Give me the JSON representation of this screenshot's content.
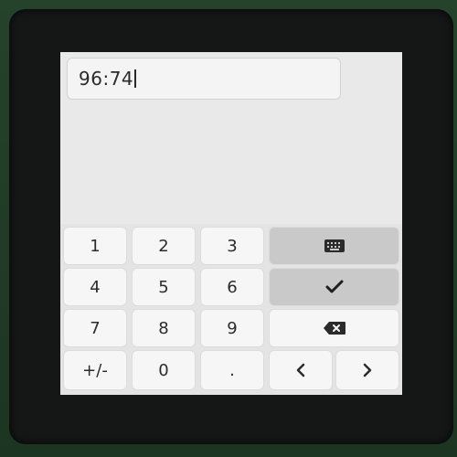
{
  "textarea": {
    "value": "96:74"
  },
  "keyboard": {
    "keys": {
      "k1": "1",
      "k2": "2",
      "k3": "3",
      "k4": "4",
      "k5": "5",
      "k6": "6",
      "k7": "7",
      "k8": "8",
      "k9": "9",
      "plusminus": "+/-",
      "k0": "0",
      "dot": "."
    },
    "icons": {
      "keyboard": "keyboard-icon",
      "ok": "checkmark-icon",
      "backspace": "backspace-icon",
      "left": "chevron-left-icon",
      "right": "chevron-right-icon"
    }
  },
  "colors": {
    "screen_bg": "#e9e9e9",
    "key_bg": "#f6f6f6",
    "special_key_bg": "#c9c9c9"
  }
}
